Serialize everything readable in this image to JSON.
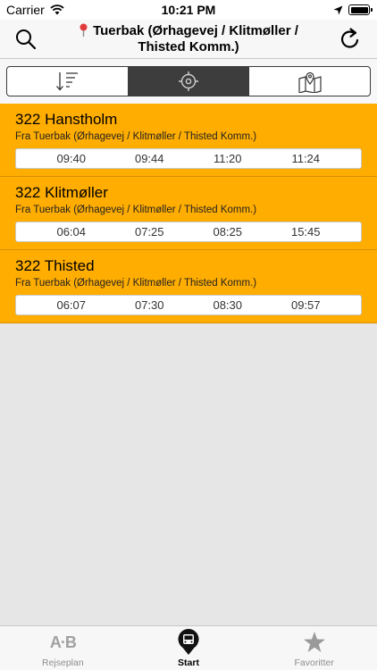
{
  "status_bar": {
    "carrier": "Carrier",
    "time": "10:21 PM"
  },
  "header": {
    "title": "Tuerbak (Ørhagevej / Klitmøller / Thisted Komm.)",
    "icons": {
      "search": "search-icon",
      "location": "pin-icon",
      "refresh": "refresh-icon"
    }
  },
  "segments": [
    {
      "icon": "sort-list-icon",
      "active": false
    },
    {
      "icon": "crosshair-icon",
      "active": true
    },
    {
      "icon": "map-icon",
      "active": false
    }
  ],
  "departures": [
    {
      "route": "322 Hanstholm",
      "from": "Fra Tuerbak (Ørhagevej / Klitmøller / Thisted Komm.)",
      "times": [
        "09:40",
        "09:44",
        "11:20",
        "11:24"
      ]
    },
    {
      "route": "322 Klitmøller",
      "from": "Fra Tuerbak (Ørhagevej / Klitmøller / Thisted Komm.)",
      "times": [
        "06:04",
        "07:25",
        "08:25",
        "15:45"
      ]
    },
    {
      "route": "322 Thisted",
      "from": "Fra Tuerbak (Ørhagevej / Klitmøller / Thisted Komm.)",
      "times": [
        "06:07",
        "07:30",
        "08:30",
        "09:57"
      ]
    }
  ],
  "tabs": [
    {
      "label": "Rejseplan",
      "icon_text": "A·B",
      "active": false
    },
    {
      "label": "Start",
      "icon": "bus-stop-icon",
      "active": true
    },
    {
      "label": "Favoritter",
      "icon": "star-icon",
      "active": false
    }
  ],
  "colors": {
    "card": "#ffad00",
    "active_segment": "#3d3d3d"
  }
}
